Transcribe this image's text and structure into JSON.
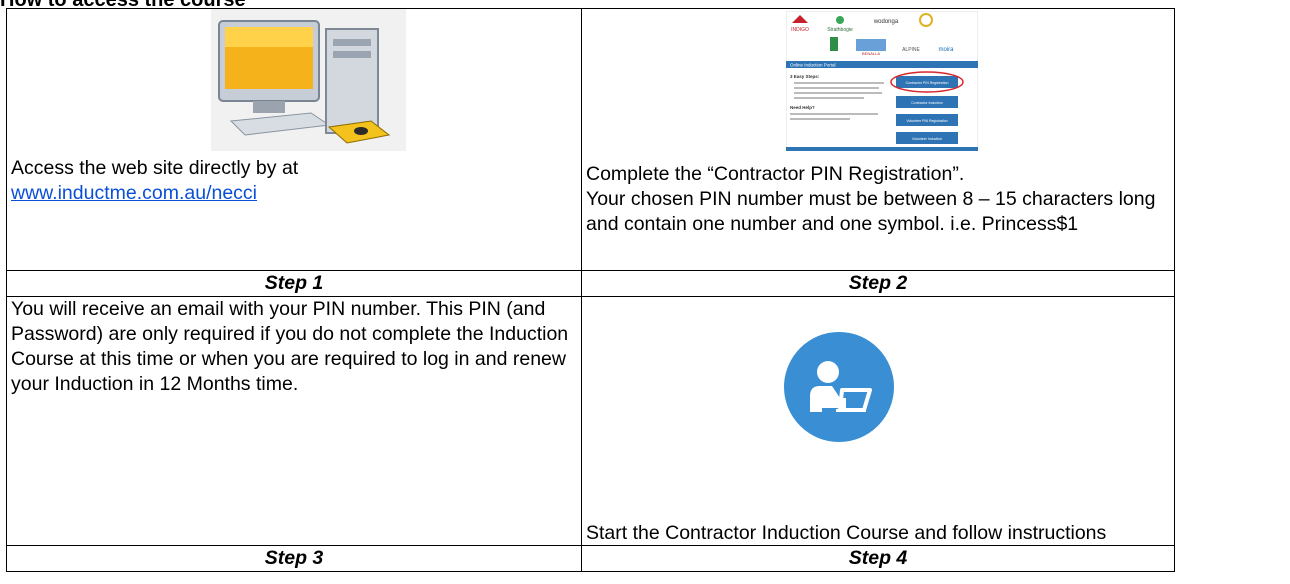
{
  "heading": "How to access the course",
  "step1": {
    "text": "Access the web site directly by at",
    "link": "www.inductme.com.au/necci",
    "label": "Step 1"
  },
  "step2": {
    "line1": "Complete the “Contractor PIN Registration”.",
    "line2": "Your chosen PIN number must be between 8 – 15 characters long and contain one number and one symbol. i.e. Princess$1",
    "label": "Step 2"
  },
  "step3": {
    "text": "You will receive an email with your PIN number. This PIN (and Password) are only required if you do not complete the Induction Course at this time or when you are required to log in and renew your Induction in 12 Months time.",
    "label": "Step 3"
  },
  "step4": {
    "text": "Start the Contractor Induction Course and follow instructions",
    "label": "Step 4"
  },
  "portal": {
    "logos": [
      "INDIGO",
      "Strathbogie",
      "wodonga",
      "BENALLA",
      "ALPINE",
      "moira"
    ],
    "bar_title": "Online Induction Portal",
    "steps_heading": "3 Easy Steps:",
    "need_help": "Need Help?",
    "buttons": [
      "Contractor PIN Registration",
      "Contractor Induction",
      "Volunteer PIN Registration",
      "Volunteer Induction"
    ]
  },
  "colors": {
    "link": "#0b4fd8",
    "portal_blue": "#2e74b5",
    "highlight_red": "#d9262c",
    "icon_blue": "#3a8fd4"
  }
}
